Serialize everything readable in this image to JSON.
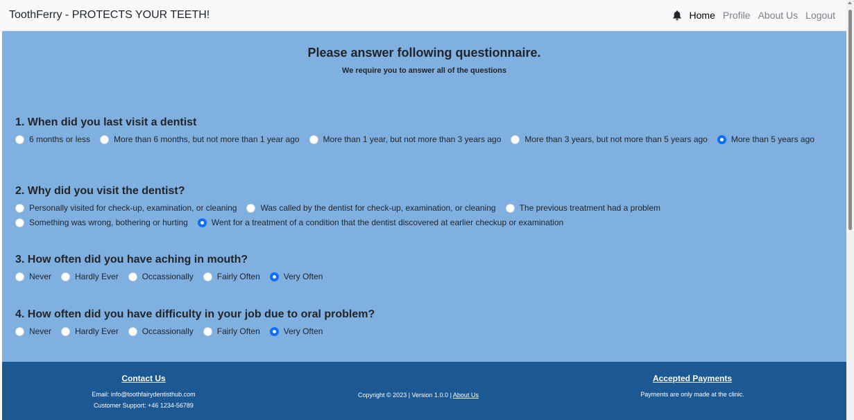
{
  "navbar": {
    "brand": "ToothFerry - PROTECTS YOUR TEETH!",
    "links": [
      "Home",
      "Profile",
      "About Us",
      "Logout"
    ]
  },
  "page": {
    "title": "Please answer following questionnaire.",
    "subtitle": "We require you to answer all of the questions"
  },
  "questions": [
    {
      "title": "1. When did you last visit a dentist",
      "options": [
        "6 months or less",
        "More than 6 months, but not more than 1 year ago",
        "More than 1 year, but not more than 3 years ago",
        "More than 3 years, but not more than 5 years ago",
        "More than 5 years ago"
      ],
      "selected": 4
    },
    {
      "title": "2. Why did you visit the dentist?",
      "options": [
        "Personally visited for check-up, examination, or cleaning",
        "Was called by the dentist for check-up, examination, or cleaning",
        "The previous treatment had a problem",
        "Something was wrong, bothering or hurting",
        "Went for a treatment of a condition that the dentist discovered at earlier checkup or examination"
      ],
      "selected": 4
    },
    {
      "title": "3. How often did you have aching in mouth?",
      "options": [
        "Never",
        "Hardly Ever",
        "Occassionally",
        "Fairly Often",
        "Very Often"
      ],
      "selected": 4
    },
    {
      "title": "4. How often did you have difficulty in your job due to oral problem?",
      "options": [
        "Never",
        "Hardly Ever",
        "Occassionally",
        "Fairly Often",
        "Very Often"
      ],
      "selected": 4
    }
  ],
  "footer": {
    "contact": {
      "heading": "Contact Us",
      "email": "Email: info@toothfairydentisthub.com",
      "support": "Customer Support: +46 1234-56789"
    },
    "center": {
      "copyright": "Copyright © 2023 | Version 1.0.0 | ",
      "about_link": "About Us"
    },
    "payments": {
      "heading": "Accepted Payments",
      "text": "Payments are only made at the clinic."
    }
  },
  "colors": {
    "main_bg": "#7fb0e0",
    "footer_bg": "#1b5894",
    "navbar_bg": "#f8f9fa",
    "radio_checked": "#0d6efd"
  },
  "icons": [
    "bell-icon",
    "scroll-up-arrow-icon"
  ]
}
